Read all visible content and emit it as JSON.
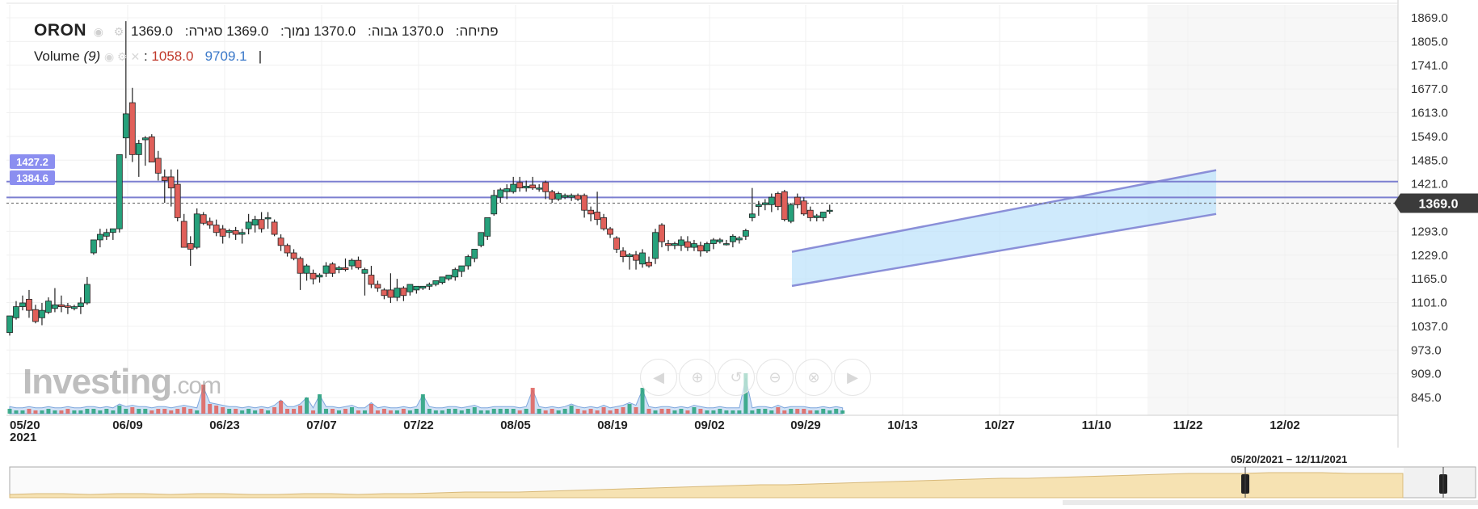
{
  "symbol": "ORON",
  "ohlc": {
    "open_label": "פתיחה:",
    "open": "1370.0",
    "high_label": "גבוה:",
    "high": "1370.0",
    "low_label": "נמוך:",
    "low": "1369.0",
    "close_label": "סגירה:",
    "close": "1369.0"
  },
  "volume_legend": {
    "label": "Volume",
    "period": "(9)",
    "value_down": "1058.0",
    "value_ma": "9709.1"
  },
  "watermark": {
    "brand": "Investing",
    "suffix": ".com"
  },
  "range_label": "05/20/2021 − 12/11/2021",
  "price_tag": "1369.0",
  "level_tags": [
    "1427.2",
    "1384.6"
  ],
  "nav_icons": [
    "arrow-left-icon",
    "zoom-in-icon",
    "zoom-reset-icon",
    "zoom-out-icon",
    "zoom-fit-icon",
    "arrow-right-icon"
  ],
  "colors": {
    "up": "#26a17b",
    "down": "#e0605a",
    "channel_fill": "#bfe3fb",
    "channel_line": "#8a8fd8",
    "hline": "#7c7fd0",
    "volume_area": "#a9c9ec",
    "navigator_fill": "#f5dca0"
  },
  "chart_data": {
    "type": "candlestick",
    "title": "ORON",
    "x_tick_labels": [
      "05/20",
      "06/09",
      "06/23",
      "07/07",
      "07/22",
      "08/05",
      "08/19",
      "09/02",
      "09/29",
      "10/13",
      "10/27",
      "11/10",
      "11/22",
      "12/02"
    ],
    "x_year_label": "2021",
    "y_tick_labels": [
      "1869.0",
      "1805.0",
      "1741.0",
      "1677.0",
      "1613.0",
      "1549.0",
      "1485.0",
      "1421.0",
      "1293.0",
      "1229.0",
      "1165.0",
      "1101.0",
      "1037.0",
      "973.0",
      "909.0",
      "845.0"
    ],
    "ylim": [
      800,
      1880
    ],
    "last_price": 1369.0,
    "horizontal_levels": [
      1427.2,
      1384.6
    ],
    "channel": {
      "start": "09/15",
      "end": "11/24",
      "lower": [
        1146,
        1340
      ],
      "upper": [
        1238,
        1458
      ]
    },
    "candles": [
      {
        "o": 1020,
        "h": 1028,
        "l": 1012,
        "c": 1065
      },
      {
        "o": 1060,
        "h": 1105,
        "l": 1055,
        "c": 1090
      },
      {
        "o": 1090,
        "h": 1120,
        "l": 1080,
        "c": 1100
      },
      {
        "o": 1110,
        "h": 1135,
        "l": 1060,
        "c": 1080
      },
      {
        "o": 1082,
        "h": 1095,
        "l": 1045,
        "c": 1050
      },
      {
        "o": 1060,
        "h": 1100,
        "l": 1040,
        "c": 1080
      },
      {
        "o": 1075,
        "h": 1115,
        "l": 1070,
        "c": 1105
      },
      {
        "o": 1085,
        "h": 1140,
        "l": 1075,
        "c": 1095
      },
      {
        "o": 1095,
        "h": 1120,
        "l": 1075,
        "c": 1090
      },
      {
        "o": 1092,
        "h": 1100,
        "l": 1070,
        "c": 1088
      },
      {
        "o": 1085,
        "h": 1095,
        "l": 1080,
        "c": 1090
      },
      {
        "o": 1090,
        "h": 1115,
        "l": 1070,
        "c": 1100
      },
      {
        "o": 1100,
        "h": 1170,
        "l": 1095,
        "c": 1150
      },
      {
        "o": 1235,
        "h": 1250,
        "l": 1230,
        "c": 1270
      },
      {
        "o": 1270,
        "h": 1300,
        "l": 1250,
        "c": 1285
      },
      {
        "o": 1280,
        "h": 1300,
        "l": 1270,
        "c": 1290
      },
      {
        "o": 1290,
        "h": 1300,
        "l": 1270,
        "c": 1300
      },
      {
        "o": 1300,
        "h": 1310,
        "l": 1290,
        "c": 1500
      },
      {
        "o": 1545,
        "h": 1860,
        "l": 1490,
        "c": 1610
      },
      {
        "o": 1640,
        "h": 1680,
        "l": 1480,
        "c": 1500
      },
      {
        "o": 1500,
        "h": 1540,
        "l": 1440,
        "c": 1530
      },
      {
        "o": 1540,
        "h": 1550,
        "l": 1470,
        "c": 1545
      },
      {
        "o": 1548,
        "h": 1555,
        "l": 1510,
        "c": 1480
      },
      {
        "o": 1490,
        "h": 1510,
        "l": 1430,
        "c": 1450
      },
      {
        "o": 1440,
        "h": 1460,
        "l": 1370,
        "c": 1430
      },
      {
        "o": 1440,
        "h": 1460,
        "l": 1360,
        "c": 1410
      },
      {
        "o": 1420,
        "h": 1460,
        "l": 1320,
        "c": 1330
      },
      {
        "o": 1320,
        "h": 1340,
        "l": 1300,
        "c": 1250
      },
      {
        "o": 1260,
        "h": 1280,
        "l": 1200,
        "c": 1245
      },
      {
        "o": 1250,
        "h": 1355,
        "l": 1245,
        "c": 1340
      },
      {
        "o": 1338,
        "h": 1345,
        "l": 1310,
        "c": 1315
      },
      {
        "o": 1320,
        "h": 1330,
        "l": 1300,
        "c": 1310
      },
      {
        "o": 1310,
        "h": 1325,
        "l": 1280,
        "c": 1290
      },
      {
        "o": 1300,
        "h": 1310,
        "l": 1260,
        "c": 1280
      },
      {
        "o": 1290,
        "h": 1300,
        "l": 1275,
        "c": 1295
      },
      {
        "o": 1295,
        "h": 1305,
        "l": 1270,
        "c": 1285
      },
      {
        "o": 1285,
        "h": 1300,
        "l": 1260,
        "c": 1290
      },
      {
        "o": 1300,
        "h": 1340,
        "l": 1285,
        "c": 1318
      },
      {
        "o": 1310,
        "h": 1335,
        "l": 1290,
        "c": 1325
      },
      {
        "o": 1325,
        "h": 1345,
        "l": 1290,
        "c": 1300
      },
      {
        "o": 1330,
        "h": 1345,
        "l": 1300,
        "c": 1330
      },
      {
        "o": 1318,
        "h": 1325,
        "l": 1280,
        "c": 1285
      },
      {
        "o": 1275,
        "h": 1285,
        "l": 1240,
        "c": 1255
      },
      {
        "o": 1255,
        "h": 1260,
        "l": 1225,
        "c": 1235
      },
      {
        "o": 1235,
        "h": 1245,
        "l": 1215,
        "c": 1220
      },
      {
        "o": 1220,
        "h": 1225,
        "l": 1135,
        "c": 1180
      },
      {
        "o": 1180,
        "h": 1205,
        "l": 1160,
        "c": 1200
      },
      {
        "o": 1180,
        "h": 1190,
        "l": 1150,
        "c": 1165
      },
      {
        "o": 1170,
        "h": 1180,
        "l": 1155,
        "c": 1175
      },
      {
        "o": 1180,
        "h": 1210,
        "l": 1170,
        "c": 1200
      },
      {
        "o": 1205,
        "h": 1210,
        "l": 1170,
        "c": 1180
      },
      {
        "o": 1190,
        "h": 1200,
        "l": 1180,
        "c": 1195
      },
      {
        "o": 1195,
        "h": 1220,
        "l": 1185,
        "c": 1190
      },
      {
        "o": 1200,
        "h": 1220,
        "l": 1190,
        "c": 1215
      },
      {
        "o": 1215,
        "h": 1225,
        "l": 1190,
        "c": 1195
      },
      {
        "o": 1180,
        "h": 1195,
        "l": 1120,
        "c": 1190
      },
      {
        "o": 1175,
        "h": 1200,
        "l": 1140,
        "c": 1150
      },
      {
        "o": 1150,
        "h": 1160,
        "l": 1130,
        "c": 1140
      },
      {
        "o": 1135,
        "h": 1140,
        "l": 1110,
        "c": 1120
      },
      {
        "o": 1135,
        "h": 1180,
        "l": 1100,
        "c": 1115
      },
      {
        "o": 1115,
        "h": 1165,
        "l": 1105,
        "c": 1140
      },
      {
        "o": 1140,
        "h": 1145,
        "l": 1105,
        "c": 1120
      },
      {
        "o": 1130,
        "h": 1150,
        "l": 1120,
        "c": 1150
      },
      {
        "o": 1135,
        "h": 1140,
        "l": 1125,
        "c": 1145
      },
      {
        "o": 1140,
        "h": 1145,
        "l": 1135,
        "c": 1145
      },
      {
        "o": 1145,
        "h": 1155,
        "l": 1135,
        "c": 1150
      },
      {
        "o": 1150,
        "h": 1160,
        "l": 1145,
        "c": 1160
      },
      {
        "o": 1155,
        "h": 1170,
        "l": 1150,
        "c": 1170
      },
      {
        "o": 1165,
        "h": 1175,
        "l": 1160,
        "c": 1175
      },
      {
        "o": 1170,
        "h": 1195,
        "l": 1160,
        "c": 1190
      },
      {
        "o": 1185,
        "h": 1195,
        "l": 1170,
        "c": 1200
      },
      {
        "o": 1200,
        "h": 1230,
        "l": 1190,
        "c": 1225
      },
      {
        "o": 1220,
        "h": 1245,
        "l": 1210,
        "c": 1245
      },
      {
        "o": 1255,
        "h": 1290,
        "l": 1250,
        "c": 1290
      },
      {
        "o": 1280,
        "h": 1330,
        "l": 1270,
        "c": 1330
      },
      {
        "o": 1340,
        "h": 1405,
        "l": 1335,
        "c": 1390
      },
      {
        "o": 1385,
        "h": 1410,
        "l": 1370,
        "c": 1405
      },
      {
        "o": 1400,
        "h": 1420,
        "l": 1380,
        "c": 1408
      },
      {
        "o": 1400,
        "h": 1440,
        "l": 1395,
        "c": 1420
      },
      {
        "o": 1425,
        "h": 1440,
        "l": 1400,
        "c": 1410
      },
      {
        "o": 1410,
        "h": 1430,
        "l": 1400,
        "c": 1415
      },
      {
        "o": 1418,
        "h": 1440,
        "l": 1405,
        "c": 1410
      },
      {
        "o": 1410,
        "h": 1420,
        "l": 1400,
        "c": 1410
      },
      {
        "o": 1425,
        "h": 1430,
        "l": 1380,
        "c": 1400
      },
      {
        "o": 1400,
        "h": 1405,
        "l": 1370,
        "c": 1380
      },
      {
        "o": 1380,
        "h": 1400,
        "l": 1375,
        "c": 1395
      },
      {
        "o": 1385,
        "h": 1395,
        "l": 1380,
        "c": 1390
      },
      {
        "o": 1385,
        "h": 1395,
        "l": 1375,
        "c": 1390
      },
      {
        "o": 1390,
        "h": 1395,
        "l": 1375,
        "c": 1380
      },
      {
        "o": 1390,
        "h": 1395,
        "l": 1330,
        "c": 1350
      },
      {
        "o": 1350,
        "h": 1360,
        "l": 1320,
        "c": 1340
      },
      {
        "o": 1345,
        "h": 1400,
        "l": 1310,
        "c": 1325
      },
      {
        "o": 1330,
        "h": 1340,
        "l": 1295,
        "c": 1300
      },
      {
        "o": 1300,
        "h": 1305,
        "l": 1275,
        "c": 1285
      },
      {
        "o": 1275,
        "h": 1280,
        "l": 1235,
        "c": 1245
      },
      {
        "o": 1240,
        "h": 1250,
        "l": 1210,
        "c": 1225
      },
      {
        "o": 1225,
        "h": 1235,
        "l": 1190,
        "c": 1230
      },
      {
        "o": 1230,
        "h": 1240,
        "l": 1190,
        "c": 1215
      },
      {
        "o": 1205,
        "h": 1245,
        "l": 1195,
        "c": 1235
      },
      {
        "o": 1210,
        "h": 1225,
        "l": 1195,
        "c": 1200
      },
      {
        "o": 1220,
        "h": 1300,
        "l": 1205,
        "c": 1290
      },
      {
        "o": 1310,
        "h": 1315,
        "l": 1250,
        "c": 1265
      },
      {
        "o": 1260,
        "h": 1270,
        "l": 1240,
        "c": 1255
      },
      {
        "o": 1255,
        "h": 1265,
        "l": 1245,
        "c": 1260
      },
      {
        "o": 1255,
        "h": 1280,
        "l": 1240,
        "c": 1270
      },
      {
        "o": 1265,
        "h": 1280,
        "l": 1240,
        "c": 1250
      },
      {
        "o": 1250,
        "h": 1270,
        "l": 1240,
        "c": 1260
      },
      {
        "o": 1255,
        "h": 1265,
        "l": 1225,
        "c": 1240
      },
      {
        "o": 1240,
        "h": 1265,
        "l": 1235,
        "c": 1260
      },
      {
        "o": 1260,
        "h": 1275,
        "l": 1245,
        "c": 1270
      },
      {
        "o": 1265,
        "h": 1275,
        "l": 1260,
        "c": 1270
      },
      {
        "o": 1260,
        "h": 1270,
        "l": 1255,
        "c": 1260
      },
      {
        "o": 1265,
        "h": 1285,
        "l": 1250,
        "c": 1280
      },
      {
        "o": 1270,
        "h": 1280,
        "l": 1260,
        "c": 1275
      },
      {
        "o": 1280,
        "h": 1300,
        "l": 1270,
        "c": 1295
      },
      {
        "o": 1330,
        "h": 1410,
        "l": 1320,
        "c": 1340
      },
      {
        "o": 1360,
        "h": 1375,
        "l": 1335,
        "c": 1365
      },
      {
        "o": 1365,
        "h": 1380,
        "l": 1350,
        "c": 1370
      },
      {
        "o": 1365,
        "h": 1395,
        "l": 1345,
        "c": 1385
      },
      {
        "o": 1395,
        "h": 1400,
        "l": 1350,
        "c": 1360
      },
      {
        "o": 1400,
        "h": 1405,
        "l": 1320,
        "c": 1325
      },
      {
        "o": 1320,
        "h": 1370,
        "l": 1315,
        "c": 1365
      },
      {
        "o": 1385,
        "h": 1395,
        "l": 1355,
        "c": 1365
      },
      {
        "o": 1375,
        "h": 1385,
        "l": 1335,
        "c": 1340
      },
      {
        "o": 1350,
        "h": 1360,
        "l": 1320,
        "c": 1330
      },
      {
        "o": 1330,
        "h": 1340,
        "l": 1320,
        "c": 1335
      },
      {
        "o": 1330,
        "h": 1345,
        "l": 1320,
        "c": 1345
      },
      {
        "o": 1350,
        "h": 1365,
        "l": 1340,
        "c": 1350
      }
    ],
    "volume": [
      3,
      2,
      2,
      3,
      2,
      2,
      3,
      2,
      2,
      3,
      2,
      2,
      3,
      3,
      2,
      3,
      2,
      5,
      3,
      4,
      3,
      3,
      2,
      3,
      3,
      2,
      3,
      4,
      3,
      2,
      18,
      6,
      5,
      4,
      3,
      3,
      2,
      3,
      2,
      3,
      2,
      4,
      8,
      3,
      3,
      5,
      10,
      2,
      12,
      3,
      3,
      2,
      3,
      4,
      2,
      2,
      6,
      2,
      3,
      2,
      2,
      3,
      2,
      3,
      12,
      3,
      2,
      2,
      3,
      3,
      2,
      3,
      4,
      2,
      2,
      3,
      3,
      3,
      3,
      2,
      3,
      16,
      3,
      2,
      3,
      2,
      3,
      5,
      3,
      2,
      3,
      2,
      4,
      2,
      3,
      4,
      6,
      4,
      16,
      3,
      2,
      3,
      3,
      2,
      3,
      2,
      4,
      3,
      2,
      2,
      3,
      2,
      2,
      2,
      25,
      2,
      3,
      3,
      2,
      4,
      2,
      3,
      3,
      3,
      2,
      2,
      3,
      2,
      3,
      2
    ]
  }
}
